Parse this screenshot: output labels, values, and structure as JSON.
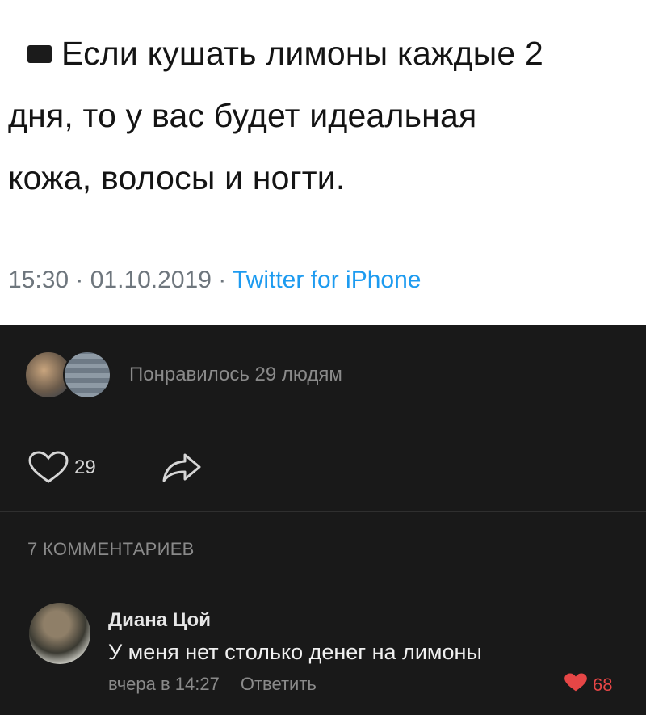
{
  "tweet": {
    "text_line1": "Если кушать лимоны каждые 2",
    "text_line2": "дня, то у вас будет идеальная",
    "text_line3": "кожа, волосы и ногти.",
    "time": "15:30 · 01.10.2019 · ",
    "source": "Twitter for iPhone"
  },
  "post": {
    "likes_summary": "Понравилось 29 людям",
    "like_count": "29",
    "comments_header": "7 КОММЕНТАРИЕВ"
  },
  "comment": {
    "author": "Диана Цой",
    "text": "У меня нет столько денег на лимоны",
    "time": "вчера в 14:27",
    "reply_label": "Ответить",
    "like_count": "68"
  },
  "colors": {
    "background": "#191919",
    "link_blue": "#1d9bf0",
    "like_red": "#e64646"
  }
}
